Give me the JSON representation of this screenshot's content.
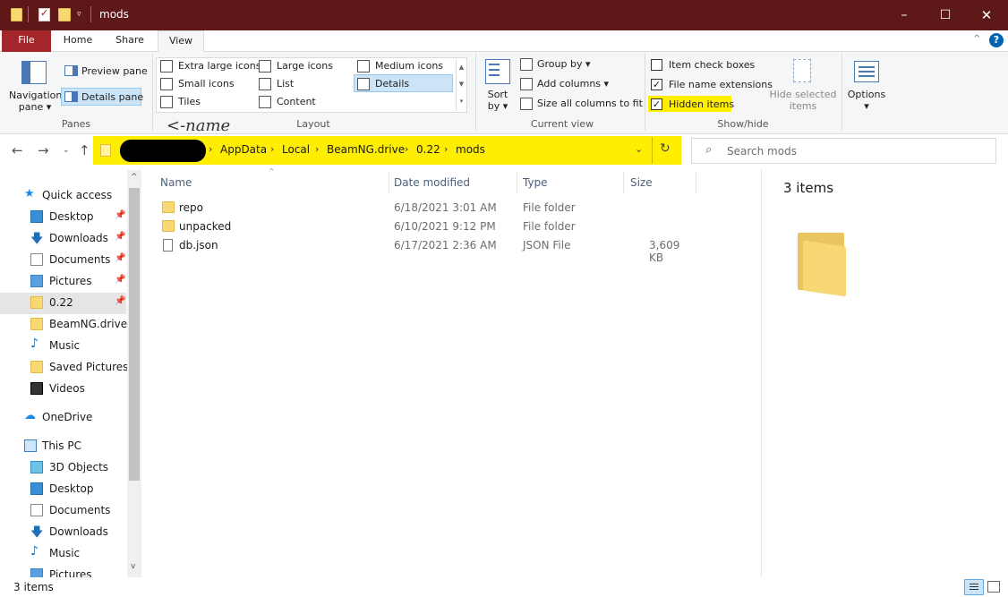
{
  "window": {
    "title": "mods",
    "colors": {
      "titlebar": "#5e1818",
      "file_tab": "#a3262a",
      "highlight": "#ffee00",
      "accent": "#0063b1"
    }
  },
  "ribbon": {
    "tabs": [
      "File",
      "Home",
      "Share",
      "View"
    ],
    "panes": {
      "label": "Panes",
      "navigation_pane": [
        "Navigation",
        "pane"
      ],
      "preview_pane": "Preview pane",
      "details_pane": "Details pane"
    },
    "layout": {
      "label": "Layout",
      "options": [
        "Extra large icons",
        "Large icons",
        "Medium icons",
        "Small icons",
        "List",
        "Details",
        "Tiles",
        "Content"
      ],
      "selected": "Details"
    },
    "current_view": {
      "label": "Current view",
      "sort_by": [
        "Sort",
        "by"
      ],
      "group_by": "Group by",
      "add_columns": "Add columns",
      "size_all_columns": "Size all columns to fit"
    },
    "show_hide": {
      "label": "Show/hide",
      "item_check_boxes": {
        "label": "Item check boxes",
        "checked": false
      },
      "file_name_extensions": {
        "label": "File name extensions",
        "checked": true
      },
      "hidden_items": {
        "label": "Hidden items",
        "checked": true
      },
      "hide_selected_items": [
        "Hide selected",
        "items"
      ]
    },
    "options": "Options"
  },
  "annotation": "<-name",
  "address": {
    "crumbs": [
      "AppData",
      "Local",
      "BeamNG.drive",
      "0.22",
      "mods"
    ],
    "search_placeholder": "Search mods"
  },
  "navigation": {
    "quick_access": "Quick access",
    "quick_items": [
      {
        "label": "Desktop",
        "icon": "desktop-icon",
        "pinned": true
      },
      {
        "label": "Downloads",
        "icon": "download-icon",
        "pinned": true
      },
      {
        "label": "Documents",
        "icon": "documents-icon",
        "pinned": true
      },
      {
        "label": "Pictures",
        "icon": "pictures-icon",
        "pinned": true
      },
      {
        "label": "0.22",
        "icon": "folder-icon",
        "pinned": true
      },
      {
        "label": "BeamNG.drive",
        "icon": "folder-icon",
        "pinned": false
      },
      {
        "label": "Music",
        "icon": "music-icon",
        "pinned": false
      },
      {
        "label": "Saved Pictures",
        "icon": "pictures-icon",
        "pinned": false
      },
      {
        "label": "Videos",
        "icon": "videos-icon",
        "pinned": false
      }
    ],
    "onedrive": "OneDrive",
    "this_pc": "This PC",
    "pc_items": [
      {
        "label": "3D Objects",
        "icon": "3d-objects-icon"
      },
      {
        "label": "Desktop",
        "icon": "desktop-icon"
      },
      {
        "label": "Documents",
        "icon": "documents-icon"
      },
      {
        "label": "Downloads",
        "icon": "download-icon"
      },
      {
        "label": "Music",
        "icon": "music-icon"
      },
      {
        "label": "Pictures",
        "icon": "pictures-icon"
      }
    ]
  },
  "files": {
    "columns": [
      "Name",
      "Date modified",
      "Type",
      "Size"
    ],
    "rows": [
      {
        "name": "repo",
        "date": "6/18/2021 3:01 AM",
        "type": "File folder",
        "size": "",
        "icon": "folder-icon"
      },
      {
        "name": "unpacked",
        "date": "6/10/2021 9:12 PM",
        "type": "File folder",
        "size": "",
        "icon": "folder-icon"
      },
      {
        "name": "db.json",
        "date": "6/17/2021 2:36 AM",
        "type": "JSON File",
        "size": "3,609 KB",
        "icon": "file-icon"
      }
    ]
  },
  "preview": {
    "count": "3 items"
  },
  "status": {
    "count": "3 items"
  }
}
